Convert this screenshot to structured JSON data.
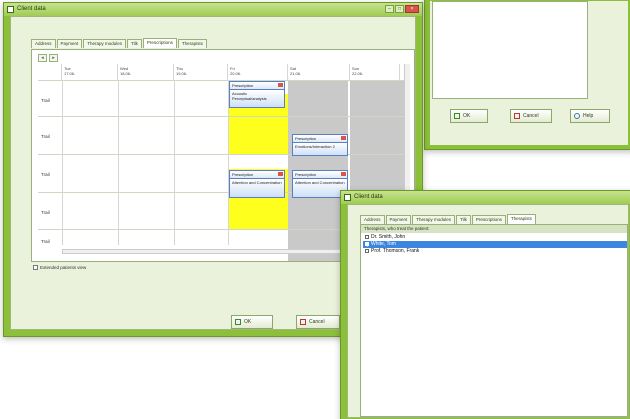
{
  "background_window": {
    "buttons": {
      "ok": "OK",
      "cancel": "Cancel",
      "help": "Help"
    }
  },
  "client_window": {
    "title": "Client data",
    "tabs": [
      "Address",
      "Payment",
      "Therapy modules",
      "Tilk",
      "Prescriptions",
      "Therapists"
    ],
    "active_tab_index": 4,
    "toolbar": {
      "back": "◂",
      "forward": "▸"
    },
    "days": [
      {
        "name": "Tue",
        "date": "17.06."
      },
      {
        "name": "Wed",
        "date": "18.06."
      },
      {
        "name": "Thu",
        "date": "19.06."
      },
      {
        "name": "Fri",
        "date": "20.06."
      },
      {
        "name": "Sat",
        "date": "21.06."
      },
      {
        "name": "Sun",
        "date": "22.06."
      }
    ],
    "rows": [
      "Trail",
      "Trail",
      "Trail",
      "Trail",
      "Trail"
    ],
    "cards": [
      {
        "title": "Prescription",
        "body": "Acoustic Perceptual/analysis"
      },
      {
        "title": "Prescription",
        "body": "Emotions/Interaction 2"
      },
      {
        "title": "Prescription",
        "body": "Attention and Concentration"
      },
      {
        "title": "Prescription",
        "body": "Attention and Concentration"
      }
    ],
    "checkbox_label": "Extended patients view",
    "buttons": {
      "ok": "OK",
      "cancel": "Cancel"
    },
    "colors": {
      "frame": "#8cbf3a",
      "highlight": "#ffff1e",
      "card_border": "#5a7fc0"
    }
  },
  "therapist_window": {
    "title": "Client data",
    "tabs": [
      "Address",
      "Payment",
      "Therapy modules",
      "Tilk",
      "Prescriptions",
      "Therapists"
    ],
    "active_tab_index": 5,
    "hint": "Therapists, who treat the patient:",
    "therapists": [
      {
        "name": "Dr. Smith, John",
        "checked": false,
        "selected": false
      },
      {
        "name": "White, Tom",
        "checked": true,
        "selected": true
      },
      {
        "name": "Prof. Thomson, Frank",
        "checked": false,
        "selected": false
      }
    ]
  }
}
